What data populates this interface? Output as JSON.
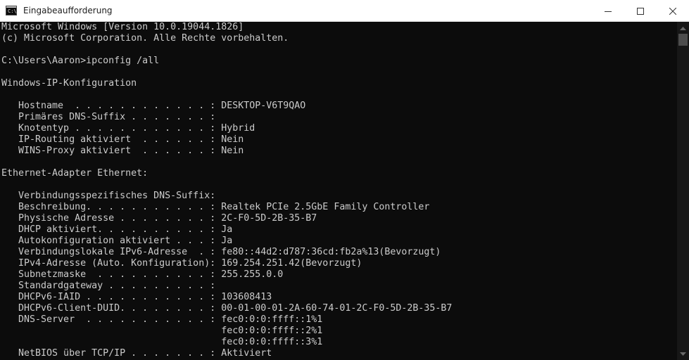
{
  "window": {
    "title": "Eingabeaufforderung",
    "icon": "cmd-icon",
    "icon_glyph": "C:\\"
  },
  "console": {
    "lines": [
      "Microsoft Windows [Version 10.0.19044.1826]",
      "(c) Microsoft Corporation. Alle Rechte vorbehalten.",
      "",
      "C:\\Users\\Aaron>ipconfig /all",
      "",
      "Windows-IP-Konfiguration",
      "",
      "   Hostname  . . . . . . . . . . . . : DESKTOP-V6T9QAO",
      "   Primäres DNS-Suffix . . . . . . . :",
      "   Knotentyp . . . . . . . . . . . . : Hybrid",
      "   IP-Routing aktiviert  . . . . . . : Nein",
      "   WINS-Proxy aktiviert  . . . . . . : Nein",
      "",
      "Ethernet-Adapter Ethernet:",
      "",
      "   Verbindungsspezifisches DNS-Suffix:",
      "   Beschreibung. . . . . . . . . . . : Realtek PCIe 2.5GbE Family Controller",
      "   Physische Adresse . . . . . . . . : 2C-F0-5D-2B-35-B7",
      "   DHCP aktiviert. . . . . . . . . . : Ja",
      "   Autokonfiguration aktiviert . . . : Ja",
      "   Verbindungslokale IPv6-Adresse  . : fe80::44d2:d787:36cd:fb2a%13(Bevorzugt)",
      "   IPv4-Adresse (Auto. Konfiguration): 169.254.251.42(Bevorzugt)",
      "   Subnetzmaske  . . . . . . . . . . : 255.255.0.0",
      "   Standardgateway . . . . . . . . . :",
      "   DHCPv6-IAID . . . . . . . . . . . : 103608413",
      "   DHCPv6-Client-DUID. . . . . . . . : 00-01-00-01-2A-60-74-01-2C-F0-5D-2B-35-B7",
      "   DNS-Server  . . . . . . . . . . . : fec0:0:0:ffff::1%1",
      "                                       fec0:0:0:ffff::2%1",
      "                                       fec0:0:0:ffff::3%1",
      "   NetBIOS über TCP/IP . . . . . . . : Aktiviert"
    ]
  },
  "colors": {
    "console_background": "#0c0c0c",
    "console_text": "#cccccc",
    "titlebar_background": "#ffffff"
  }
}
